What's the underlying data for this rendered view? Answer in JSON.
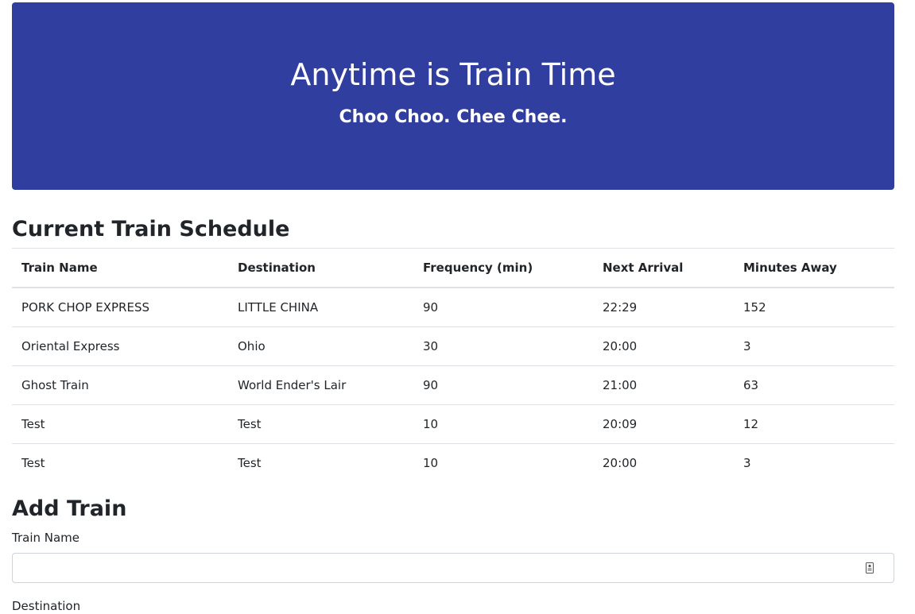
{
  "header": {
    "title": "Anytime is Train Time",
    "subtitle": "Choo Choo. Chee Chee."
  },
  "schedule": {
    "heading": "Current Train Schedule",
    "columns": [
      "Train Name",
      "Destination",
      "Frequency (min)",
      "Next Arrival",
      "Minutes Away"
    ],
    "rows": [
      [
        "PORK CHOP EXPRESS",
        "LITTLE CHINA",
        "90",
        "22:29",
        "152"
      ],
      [
        "Oriental Express",
        "Ohio",
        "30",
        "20:00",
        "3"
      ],
      [
        "Ghost Train",
        "World Ender's Lair",
        "90",
        "21:00",
        "63"
      ],
      [
        "Test",
        "Test",
        "10",
        "20:09",
        "12"
      ],
      [
        "Test",
        "Test",
        "10",
        "20:00",
        "3"
      ]
    ]
  },
  "add_train": {
    "heading": "Add Train",
    "train_name_label": "Train Name",
    "train_name_value": "",
    "destination_label": "Destination",
    "autofill_icon": "contact-card-icon"
  },
  "colors": {
    "header_bg": "#303f9f",
    "header_text": "#ffffff",
    "border": "#dee2e6"
  }
}
